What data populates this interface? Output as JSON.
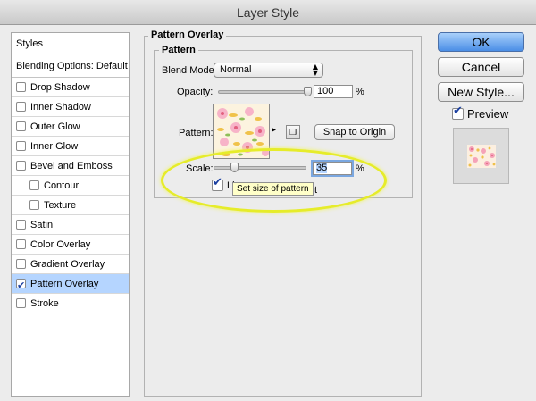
{
  "window": {
    "title": "Layer Style"
  },
  "styles_panel": {
    "header": "Styles",
    "blending_options": "Blending Options: Default",
    "items": [
      {
        "label": "Drop Shadow",
        "checked": false,
        "indent": false,
        "selected": false
      },
      {
        "label": "Inner Shadow",
        "checked": false,
        "indent": false,
        "selected": false
      },
      {
        "label": "Outer Glow",
        "checked": false,
        "indent": false,
        "selected": false
      },
      {
        "label": "Inner Glow",
        "checked": false,
        "indent": false,
        "selected": false
      },
      {
        "label": "Bevel and Emboss",
        "checked": false,
        "indent": false,
        "selected": false
      },
      {
        "label": "Contour",
        "checked": false,
        "indent": true,
        "selected": false
      },
      {
        "label": "Texture",
        "checked": false,
        "indent": true,
        "selected": false
      },
      {
        "label": "Satin",
        "checked": false,
        "indent": false,
        "selected": false
      },
      {
        "label": "Color Overlay",
        "checked": false,
        "indent": false,
        "selected": false
      },
      {
        "label": "Gradient Overlay",
        "checked": false,
        "indent": false,
        "selected": false
      },
      {
        "label": "Pattern Overlay",
        "checked": true,
        "indent": false,
        "selected": true
      },
      {
        "label": "Stroke",
        "checked": false,
        "indent": false,
        "selected": false
      }
    ]
  },
  "pattern_overlay": {
    "group_title": "Pattern Overlay",
    "sub_title": "Pattern",
    "blend_mode_label": "Blend Mode:",
    "blend_mode_value": "Normal",
    "opacity_label": "Opacity:",
    "opacity_value": "100",
    "opacity_level": 1.0,
    "opacity_unit": "%",
    "pattern_label": "Pattern:",
    "snap_button": "Snap to Origin",
    "scale_label": "Scale:",
    "scale_value": "35",
    "scale_level": 0.07,
    "scale_unit": "%",
    "link_label_visible": "Li",
    "link_label_tail": "t",
    "link_checked": true,
    "tooltip": "Set size of pattern"
  },
  "buttons": {
    "ok": "OK",
    "cancel": "Cancel",
    "new_style": "New Style...",
    "preview_label": "Preview",
    "preview_checked": true
  },
  "colors": {
    "selected_row": "#b5d5ff",
    "default_button": "#4b8ee6",
    "tooltip_bg": "#ffffc8",
    "highlight": "#e6ec2a"
  }
}
